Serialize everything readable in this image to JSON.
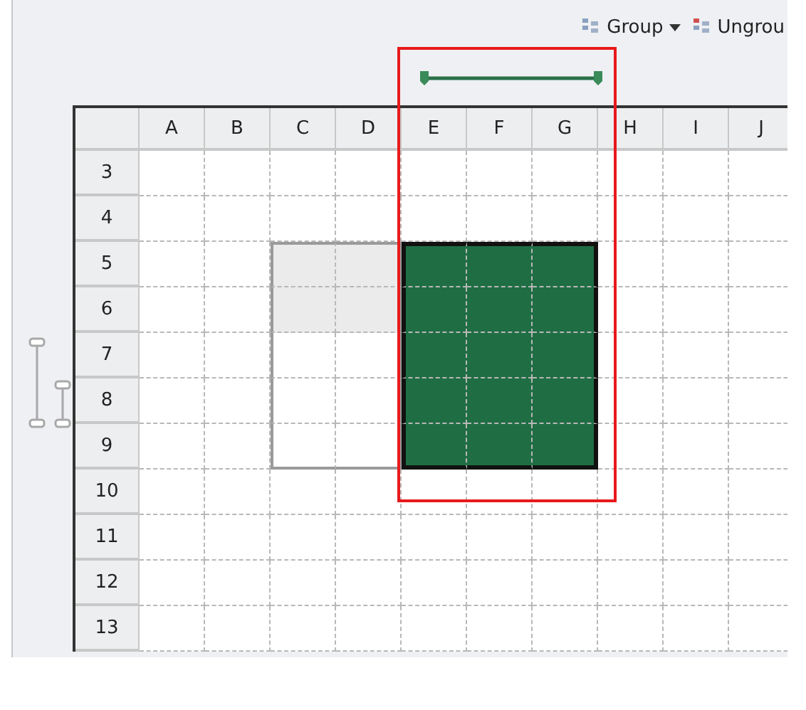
{
  "toolbar": [
    {
      "label": "Group",
      "has_dropdown": true
    },
    {
      "label": "Ungrou",
      "has_dropdown": false
    }
  ],
  "columns": [
    {
      "label": "A",
      "grouped": false
    },
    {
      "label": "B",
      "grouped": false
    },
    {
      "label": "C",
      "grouped": false
    },
    {
      "label": "D",
      "grouped": false
    },
    {
      "label": "E",
      "grouped": true
    },
    {
      "label": "F",
      "grouped": true
    },
    {
      "label": "G",
      "grouped": true
    },
    {
      "label": "H",
      "grouped": false
    },
    {
      "label": "I",
      "grouped": false
    },
    {
      "label": "J",
      "grouped": false
    }
  ],
  "rows": [
    {
      "label": "3",
      "cells": [
        {
          "kind": "plain"
        },
        {
          "kind": "plain"
        },
        {
          "kind": "plain"
        },
        {
          "kind": "plain"
        },
        {
          "kind": "plain"
        },
        {
          "kind": "plain"
        },
        {
          "kind": "plain"
        },
        {
          "kind": "plain"
        },
        {
          "kind": "plain"
        },
        {
          "kind": "plain"
        }
      ]
    },
    {
      "label": "4",
      "cells": [
        {
          "kind": "plain"
        },
        {
          "kind": "plain"
        },
        {
          "kind": "plain"
        },
        {
          "kind": "plain"
        },
        {
          "kind": "plain"
        },
        {
          "kind": "plain"
        },
        {
          "kind": "plain"
        },
        {
          "kind": "plain"
        },
        {
          "kind": "plain"
        },
        {
          "kind": "plain"
        }
      ]
    },
    {
      "label": "5",
      "cells": [
        {
          "kind": "plain"
        },
        {
          "kind": "plain"
        },
        {
          "kind": "shaded"
        },
        {
          "kind": "shaded"
        },
        {
          "kind": "selected"
        },
        {
          "kind": "selected"
        },
        {
          "kind": "selected"
        },
        {
          "kind": "plain"
        },
        {
          "kind": "plain"
        },
        {
          "kind": "plain"
        }
      ]
    },
    {
      "label": "6",
      "cells": [
        {
          "kind": "plain"
        },
        {
          "kind": "plain"
        },
        {
          "kind": "shaded"
        },
        {
          "kind": "shaded"
        },
        {
          "kind": "selected"
        },
        {
          "kind": "selected"
        },
        {
          "kind": "selected"
        },
        {
          "kind": "plain"
        },
        {
          "kind": "plain"
        },
        {
          "kind": "plain"
        }
      ]
    },
    {
      "label": "7",
      "cells": [
        {
          "kind": "plain"
        },
        {
          "kind": "plain"
        },
        {
          "kind": "outlined"
        },
        {
          "kind": "outlined"
        },
        {
          "kind": "selected"
        },
        {
          "kind": "selected"
        },
        {
          "kind": "selected"
        },
        {
          "kind": "plain"
        },
        {
          "kind": "plain"
        },
        {
          "kind": "plain"
        }
      ]
    },
    {
      "label": "8",
      "cells": [
        {
          "kind": "plain"
        },
        {
          "kind": "plain"
        },
        {
          "kind": "outlined"
        },
        {
          "kind": "outlined"
        },
        {
          "kind": "selected"
        },
        {
          "kind": "selected"
        },
        {
          "kind": "selected"
        },
        {
          "kind": "plain"
        },
        {
          "kind": "plain"
        },
        {
          "kind": "plain"
        }
      ]
    },
    {
      "label": "9",
      "cells": [
        {
          "kind": "plain"
        },
        {
          "kind": "plain"
        },
        {
          "kind": "outlined"
        },
        {
          "kind": "outlined"
        },
        {
          "kind": "selected"
        },
        {
          "kind": "selected"
        },
        {
          "kind": "selected"
        },
        {
          "kind": "plain"
        },
        {
          "kind": "plain"
        },
        {
          "kind": "plain"
        }
      ]
    },
    {
      "label": "10",
      "cells": [
        {
          "kind": "plain"
        },
        {
          "kind": "plain"
        },
        {
          "kind": "plain"
        },
        {
          "kind": "plain"
        },
        {
          "kind": "plain"
        },
        {
          "kind": "plain"
        },
        {
          "kind": "plain"
        },
        {
          "kind": "plain"
        },
        {
          "kind": "plain"
        },
        {
          "kind": "plain"
        }
      ]
    },
    {
      "label": "11",
      "cells": [
        {
          "kind": "plain"
        },
        {
          "kind": "plain"
        },
        {
          "kind": "plain"
        },
        {
          "kind": "plain"
        },
        {
          "kind": "plain"
        },
        {
          "kind": "plain"
        },
        {
          "kind": "plain"
        },
        {
          "kind": "plain"
        },
        {
          "kind": "plain"
        },
        {
          "kind": "plain"
        }
      ]
    },
    {
      "label": "12",
      "cells": [
        {
          "kind": "plain"
        },
        {
          "kind": "plain"
        },
        {
          "kind": "plain"
        },
        {
          "kind": "plain"
        },
        {
          "kind": "plain"
        },
        {
          "kind": "plain"
        },
        {
          "kind": "plain"
        },
        {
          "kind": "plain"
        },
        {
          "kind": "plain"
        },
        {
          "kind": "plain"
        }
      ]
    },
    {
      "label": "13",
      "cells": [
        {
          "kind": "plain"
        },
        {
          "kind": "plain"
        },
        {
          "kind": "plain"
        },
        {
          "kind": "plain"
        },
        {
          "kind": "plain"
        },
        {
          "kind": "plain"
        },
        {
          "kind": "plain"
        },
        {
          "kind": "plain"
        },
        {
          "kind": "plain"
        },
        {
          "kind": "plain"
        }
      ]
    }
  ]
}
